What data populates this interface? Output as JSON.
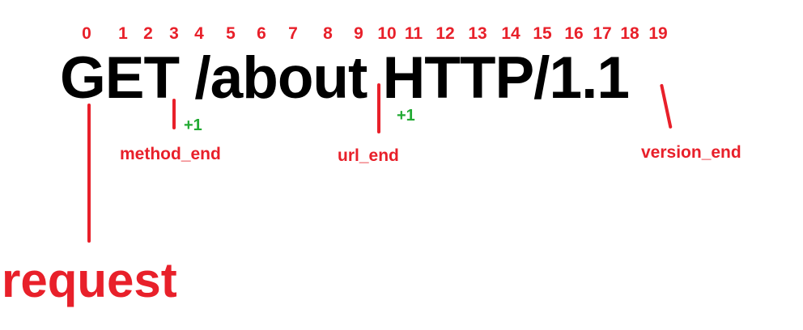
{
  "indices": [
    "0",
    "1",
    "2",
    "3",
    "4",
    "5",
    "6",
    "7",
    "8",
    "9",
    "10",
    "11",
    "12",
    "13",
    "14",
    "15",
    "16",
    "17",
    "18",
    "19"
  ],
  "request_line": "GET /about HTTP/1.1",
  "labels": {
    "method_end": "method_end",
    "url_end": "url_end",
    "version_end": "version_end",
    "request": "request"
  },
  "offsets": {
    "method_plus": "+1",
    "url_plus": "+1"
  },
  "colors": {
    "index_text": "#e8202a",
    "marker": "#e8202a",
    "plus_text": "#22aa33",
    "request_text": "#000000"
  }
}
